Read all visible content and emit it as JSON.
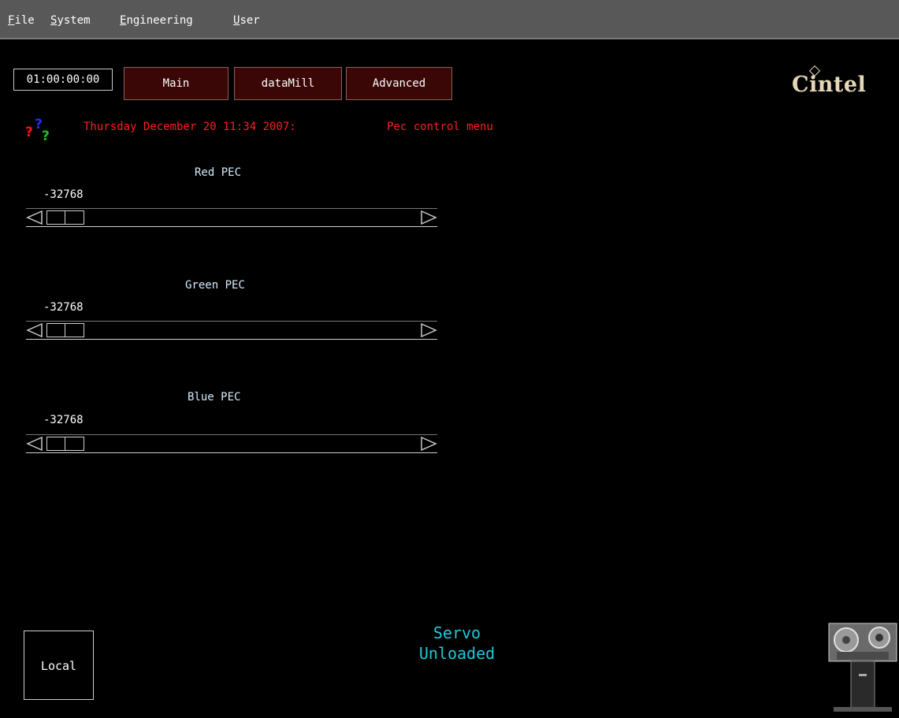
{
  "menubar": {
    "items": [
      {
        "first": "F",
        "rest": "ile"
      },
      {
        "first": "S",
        "rest": "ystem"
      },
      {
        "first": "E",
        "rest": "ngineering"
      },
      {
        "first": "U",
        "rest": "ser"
      }
    ]
  },
  "toolbar": {
    "timecode": "01:00:00:00",
    "main_label": "Main",
    "datamill_label": "dataMill",
    "advanced_label": "Advanced"
  },
  "logo": {
    "text": "Cintel"
  },
  "status": {
    "datetime": "Thursday December 20 11:34 2007:",
    "menu_title": "Pec control menu"
  },
  "sliders": [
    {
      "label": "Red PEC",
      "value": "-32768"
    },
    {
      "label": "Green PEC",
      "value": "-32768"
    },
    {
      "label": "Blue PEC",
      "value": "-32768"
    }
  ],
  "local_label": "Local",
  "servo": {
    "line1": "Servo",
    "line2": "Unloaded"
  },
  "colors": {
    "menubar_bg": "#585858",
    "button_bg": "#3b0606",
    "status_red": "#ff1e1e",
    "servo_cyan": "#22c8d8",
    "logo_color": "#e6d7b8"
  },
  "icons": [
    "help-icon",
    "scroll-left-arrow-icon",
    "scroll-right-arrow-icon",
    "telecine-machine-icon"
  ]
}
